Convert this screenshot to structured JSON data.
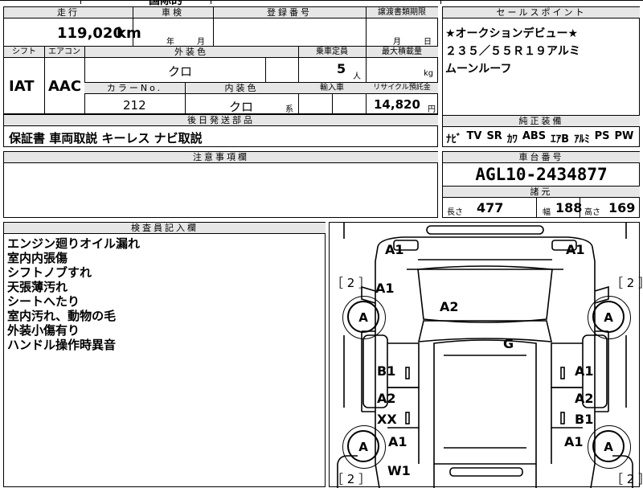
{
  "top_fragment": "国际的",
  "header_labels": {
    "mileage": "走行",
    "inspection": "車検",
    "registration": "登録番号",
    "transfer_deadline": "譲渡書類期限",
    "shift": "シフト",
    "aircon": "エアコン",
    "exterior_color": "外装色",
    "capacity": "乗車定員",
    "max_load": "最大積載量",
    "color_no": "カラーNo.",
    "interior_color": "内装色",
    "import": "輸入車",
    "recycle_deposit": "リサイクル預託金",
    "later_parts": "後日発送部品",
    "sales_point": "セールスポイント",
    "genuine_equipment": "純正装備",
    "notes": "注意事項欄",
    "chassis_no": "車台番号",
    "specs": "諸元",
    "inspector_notes": "検査員記入欄"
  },
  "vehicle": {
    "mileage": "119,020",
    "mileage_unit": "km",
    "inspection_year": "年",
    "inspection_month": "月",
    "transfer_month": "月",
    "transfer_day": "日",
    "shift": "IAT",
    "aircon": "AAC",
    "exterior_color": "クロ",
    "capacity": "5",
    "capacity_unit": "人",
    "max_load_unit": "kg",
    "color_no": "212",
    "interior_color": "クロ",
    "interior_suffix": "系",
    "recycle_deposit": "14,820",
    "recycle_unit": "円",
    "later_parts": "保証書 車両取説 キーレス ナビ取説",
    "chassis_no": "AGL10-2434877",
    "length_label": "長さ",
    "length": "477",
    "width_label": "幅",
    "width": "188",
    "height_label": "高さ",
    "height": "169"
  },
  "sales_point": [
    "★オークションデビュー★",
    "２３５／５５Ｒ１９アルミ",
    "ムーンルーフ"
  ],
  "genuine_equipment": [
    "ﾅﾋﾞ",
    "TV",
    "SR",
    "ｶﾜ",
    "ABS",
    "ｴｱB",
    "ｱﾙﾐ",
    "PS",
    "PW"
  ],
  "inspector_notes": [
    "エンジン廻りオイル漏れ",
    "室内内張傷",
    "シフトノブすれ",
    "天張薄汚れ",
    "シートへたり",
    "室内汚れ、動物の毛",
    "外装小傷有り",
    "ハンドル操作時異音"
  ],
  "diagram": {
    "tire_left_front": "［ 2 ］",
    "tire_right_front": "［ 2 ］",
    "tire_left_rear": "［ 2 ］",
    "tire_right_rear": "［ 2 ］",
    "marks": {
      "front_left_bumper": "A1",
      "front_right_bumper": "A1",
      "left_fender": "A1",
      "hood": "A2",
      "roof": "G",
      "left_front_wheel": "A",
      "right_front_wheel": "A",
      "left_front_door": "B1",
      "right_front_door": "A1",
      "left_rear_door_a": "A2",
      "left_rear_door_b": "XX",
      "right_rear_door_a": "A2",
      "right_rear_door_b": "B1",
      "left_rear_fender": "A1",
      "right_rear_fender": "A1",
      "left_rear_wheel": "A",
      "right_rear_wheel": "A",
      "left_rear_bumper": "W1"
    }
  }
}
